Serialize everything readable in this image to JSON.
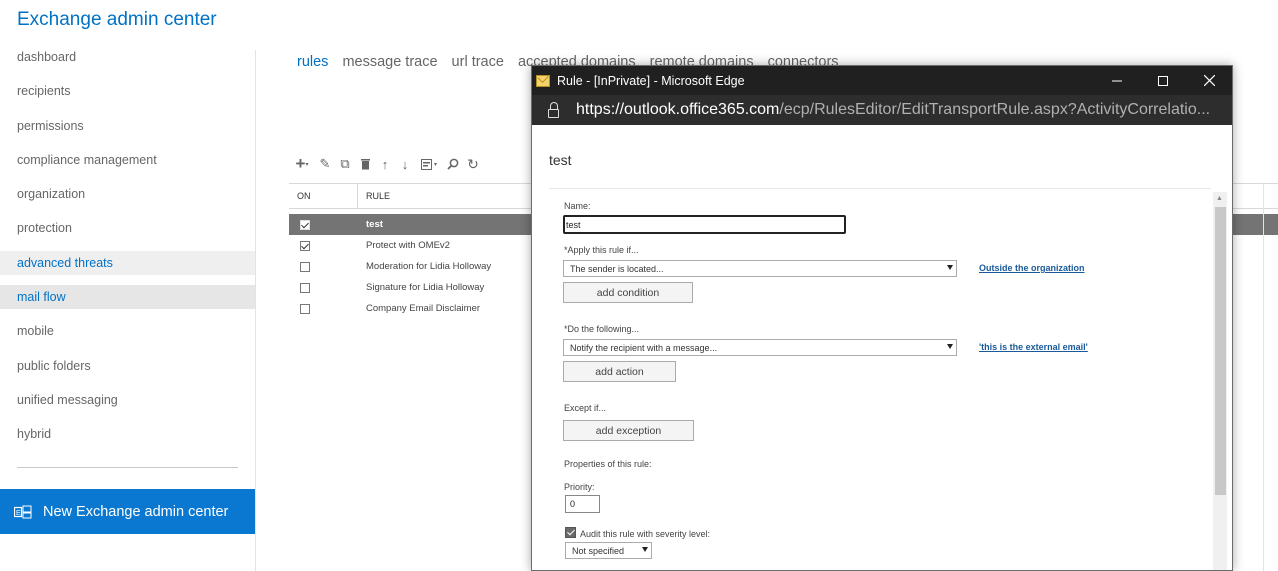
{
  "app": {
    "title": "Exchange admin center"
  },
  "nav": {
    "items": [
      {
        "label": "dashboard"
      },
      {
        "label": "recipients"
      },
      {
        "label": "permissions"
      },
      {
        "label": "compliance management"
      },
      {
        "label": "organization"
      },
      {
        "label": "protection"
      },
      {
        "label": "advanced threats"
      },
      {
        "label": "mail flow"
      },
      {
        "label": "mobile"
      },
      {
        "label": "public folders"
      },
      {
        "label": "unified messaging"
      },
      {
        "label": "hybrid"
      }
    ],
    "new_eac": "New Exchange admin center"
  },
  "tabs": [
    {
      "label": "rules"
    },
    {
      "label": "message trace"
    },
    {
      "label": "url trace"
    },
    {
      "label": "accepted domains"
    },
    {
      "label": "remote domains"
    },
    {
      "label": "connectors"
    }
  ],
  "grid": {
    "col_on": "ON",
    "col_rule": "RULE",
    "rows": [
      {
        "name": "test",
        "on": true,
        "selected": true
      },
      {
        "name": "Protect with OMEv2",
        "on": true,
        "selected": false
      },
      {
        "name": "Moderation for Lidia Holloway",
        "on": false,
        "selected": false
      },
      {
        "name": "Signature for Lidia Holloway",
        "on": false,
        "selected": false
      },
      {
        "name": "Company Email Disclaimer",
        "on": false,
        "selected": false
      }
    ]
  },
  "popup": {
    "window_title": "Rule - [InPrivate] - Microsoft Edge",
    "url_host": "https://outlook.office365.com",
    "url_path": "/ecp/RulesEditor/EditTransportRule.aspx?ActivityCorrelatio...",
    "dialog_title": "test",
    "name_label": "Name:",
    "name_value": "test",
    "apply_label": "*Apply this rule if...",
    "apply_select": "The sender is located...",
    "apply_link": "Outside the organization",
    "add_condition": "add condition",
    "do_label": "*Do the following...",
    "do_select": "Notify the recipient with a message...",
    "do_link": "'this is the external email'",
    "add_action": "add action",
    "except_label": "Except if...",
    "add_exception": "add exception",
    "properties_label": "Properties of this rule:",
    "priority_label": "Priority:",
    "priority_value": "0",
    "audit_label": "Audit this rule with severity level:",
    "severity_select": "Not specified"
  }
}
